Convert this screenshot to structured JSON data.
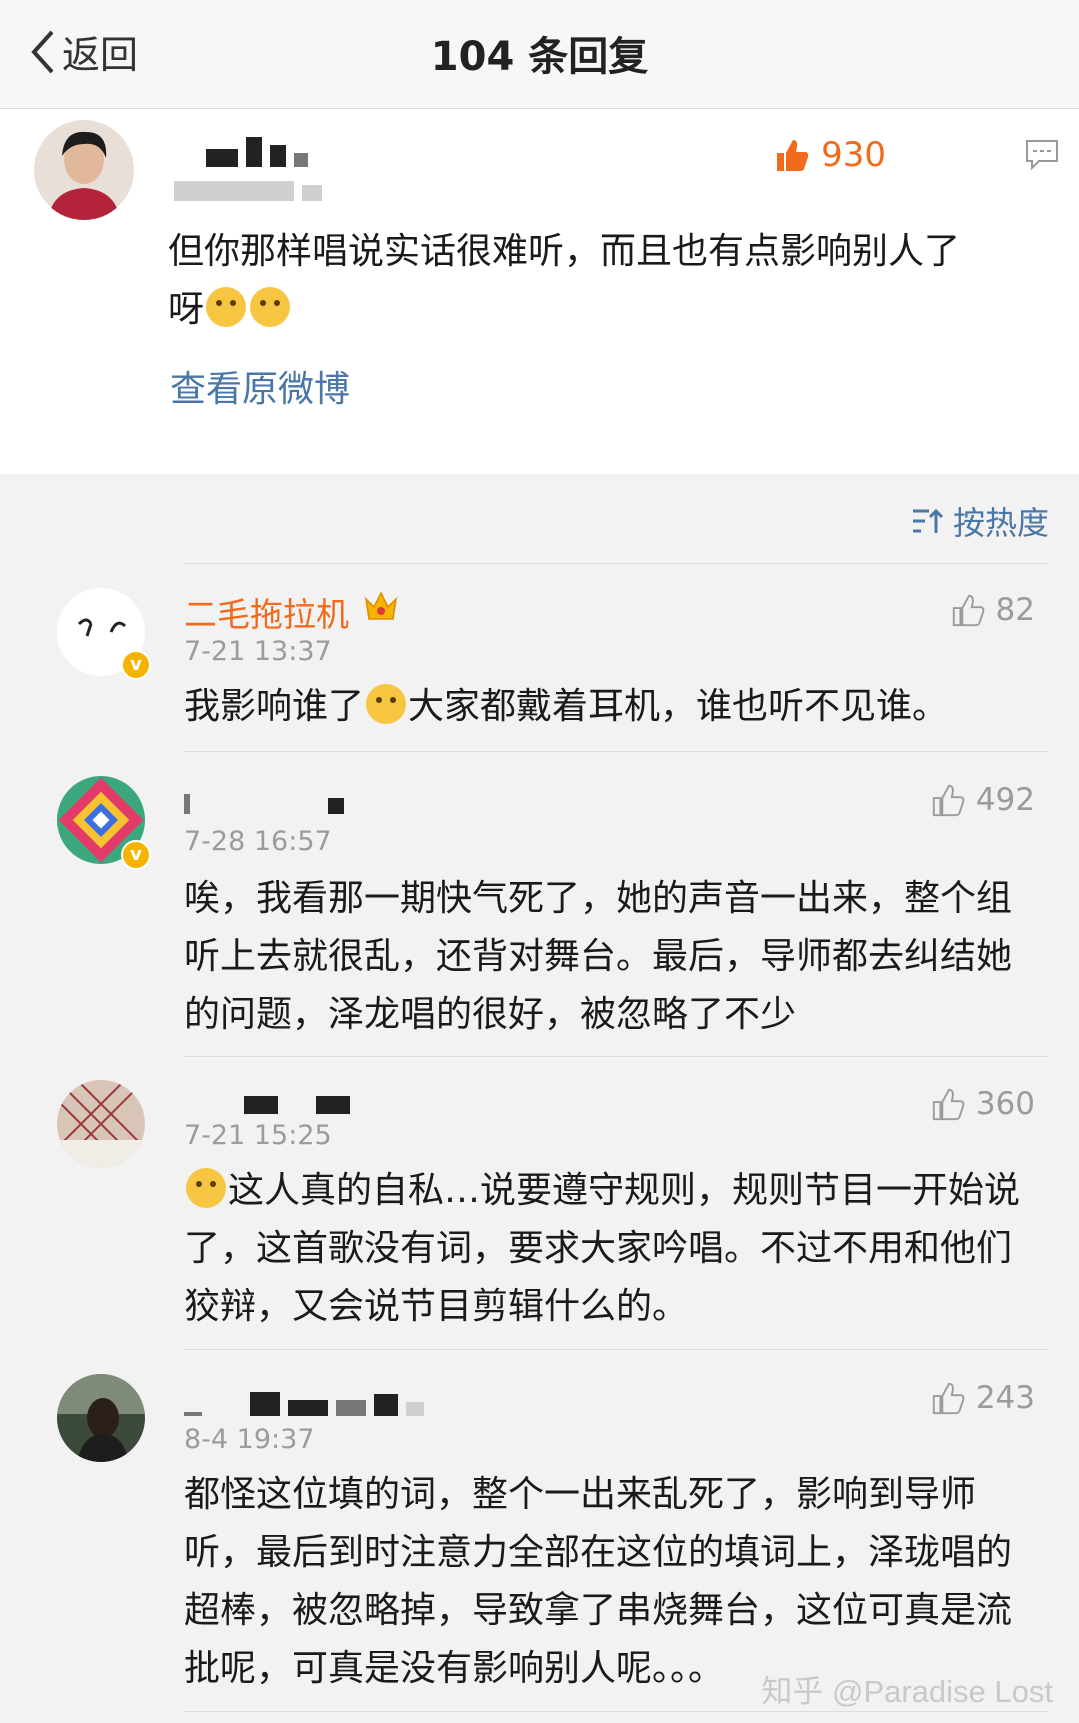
{
  "navbar": {
    "back_label": "返回",
    "title": "104 条回复"
  },
  "root_comment": {
    "likes": "930",
    "text": "但你那样唱说实话很难听，而且也有点影响别人了呀",
    "view_original": "查看原微博"
  },
  "sort": {
    "label": "按热度"
  },
  "replies": [
    {
      "name": "二毛拖拉机",
      "time": "7-21 13:37",
      "likes": "82",
      "text_before": "我影响谁了",
      "text_after": "大家都戴着耳机，谁也听不见谁。"
    },
    {
      "time": "7-28 16:57",
      "likes": "492",
      "text": "唉，我看那一期快气死了，她的声音一出来，整个组听上去就很乱，还背对舞台。最后，导师都去纠结她的问题，泽龙唱的很好，被忽略了不少"
    },
    {
      "time": "7-21 15:25",
      "likes": "360",
      "text": "这人真的自私…说要遵守规则，规则节目一开始说了，这首歌没有词，要求大家吟唱。不过不用和他们狡辩，又会说节目剪辑什么的。"
    },
    {
      "time": "8-4 19:37",
      "likes": "243",
      "text": "都怪这位填的词，整个一出来乱死了，影响到导师听，最后到时注意力全部在这位的填词上，泽珑唱的超棒，被忽略掉，导致拿了串烧舞台，这位可真是流批呢，可真是没有影响别人呢。。。"
    }
  ],
  "watermark": "知乎 @Paradise Lost",
  "colors": {
    "accent": "#f26a1b",
    "link": "#4a76a8"
  }
}
